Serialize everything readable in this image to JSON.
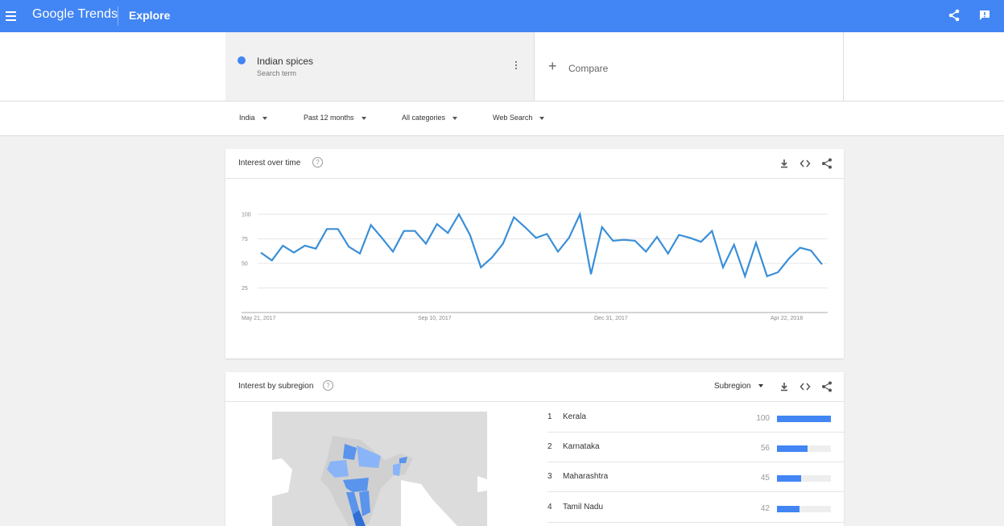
{
  "header": {
    "logo": "Google Trends",
    "section": "Explore",
    "icons": [
      "menu-icon",
      "share-icon",
      "feedback-icon"
    ]
  },
  "search": {
    "term": "Indian spices",
    "term_type": "Search term",
    "term_color": "#4285f4",
    "compare_label": "Compare"
  },
  "filters": {
    "region": "India",
    "time": "Past 12 months",
    "category": "All categories",
    "search_type": "Web Search"
  },
  "interest_over_time": {
    "title": "Interest over time",
    "help": "?",
    "icons": [
      "download-icon",
      "embed-icon",
      "share-icon"
    ]
  },
  "interest_by_subregion": {
    "title": "Interest by subregion",
    "help": "?",
    "select_label": "Subregion",
    "icons": [
      "download-icon",
      "embed-icon",
      "share-icon"
    ],
    "rows": [
      {
        "rank": "1",
        "name": "Kerala",
        "value": 100
      },
      {
        "rank": "2",
        "name": "Karnataka",
        "value": 56
      },
      {
        "rank": "3",
        "name": "Maharashtra",
        "value": 45
      },
      {
        "rank": "4",
        "name": "Tamil Nadu",
        "value": 42
      }
    ]
  },
  "colors": {
    "brand": "#4285f4",
    "line": "#3a8fd8",
    "map_highlight_light": "#8ab4f8",
    "map_highlight_mid": "#5a94ec",
    "map_highlight_dark": "#2f6fd6",
    "map_base": "#dcdcdc"
  },
  "chart_data": {
    "type": "line",
    "title": "",
    "xlabel": "",
    "ylabel": "",
    "ylim": [
      0,
      100
    ],
    "y_ticks": [
      25,
      50,
      75,
      100
    ],
    "x_tick_labels": [
      "May 21, 2017",
      "Sep 10, 2017",
      "Dec 31, 2017",
      "Apr 22, 2018"
    ],
    "grid": true,
    "series": [
      {
        "values": [
          61,
          53,
          68,
          61,
          68,
          65,
          85,
          85,
          67,
          60,
          89,
          76,
          62,
          83,
          83,
          70,
          90,
          81,
          100,
          79,
          46,
          56,
          70,
          97,
          87,
          76,
          80,
          62,
          76,
          100,
          39,
          87,
          73,
          74,
          73,
          62,
          77,
          60,
          79,
          76,
          72,
          83,
          46,
          69,
          37,
          71,
          37,
          41,
          55,
          66,
          63,
          49
        ]
      }
    ]
  }
}
